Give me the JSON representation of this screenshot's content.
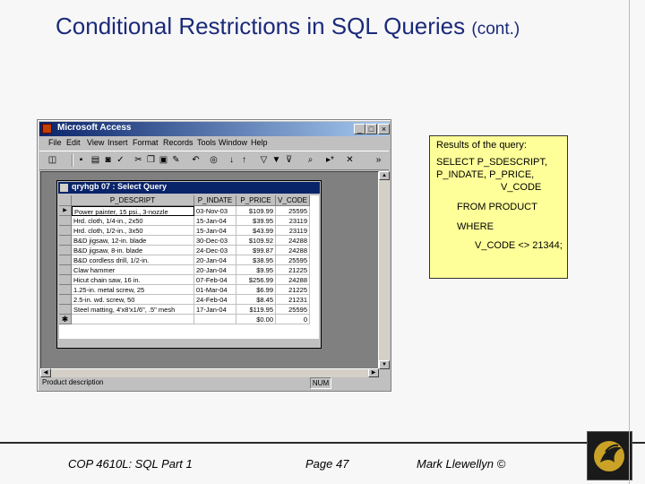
{
  "slide": {
    "title": "Conditional Restrictions in SQL Queries",
    "title_suffix": "(cont.)"
  },
  "access_window": {
    "title": "Microsoft Access",
    "controls": [
      "_",
      "□",
      "×"
    ],
    "menu": [
      "File",
      "Edit",
      "View",
      "Insert",
      "Format",
      "Records",
      "Tools",
      "Window",
      "Help"
    ],
    "toolbar_icons": [
      "view-icon",
      "save-icon",
      "print-icon",
      "print-preview-icon",
      "spelling-icon",
      "cut-icon",
      "copy-icon",
      "paste-icon",
      "format-painter-icon",
      "undo-icon",
      "insert-hyperlink-icon",
      "sort-ascending-icon",
      "sort-descending-icon",
      "filter-by-selection-icon",
      "filter-by-form-icon",
      "apply-filter-icon",
      "find-icon",
      "new-record-icon",
      "delete-record-icon"
    ],
    "status_text": "Product description",
    "status_num": "NUM"
  },
  "query_window": {
    "title": "qryhgb 07 : Select Query",
    "columns": [
      "P_DESCRIPT",
      "P_INDATE",
      "P_PRICE",
      "V_CODE"
    ],
    "rows": [
      {
        "desc": "Power painter, 15 psi., 3-nozzle",
        "date": "03-Nov-03",
        "price": "$109.99",
        "vcode": "25595"
      },
      {
        "desc": "Hrd. cloth, 1/4-in., 2x50",
        "date": "15-Jan-04",
        "price": "$39.95",
        "vcode": "23119"
      },
      {
        "desc": "Hrd. cloth, 1/2-in., 3x50",
        "date": "15-Jan-04",
        "price": "$43.99",
        "vcode": "23119"
      },
      {
        "desc": "B&D jigsaw, 12-in. blade",
        "date": "30-Dec-03",
        "price": "$109.92",
        "vcode": "24288"
      },
      {
        "desc": "B&D jigsaw, 8-in. blade",
        "date": "24-Dec-03",
        "price": "$99.87",
        "vcode": "24288"
      },
      {
        "desc": "B&D cordless drill, 1/2-in.",
        "date": "20-Jan-04",
        "price": "$38.95",
        "vcode": "25595"
      },
      {
        "desc": "Claw hammer",
        "date": "20-Jan-04",
        "price": "$9.95",
        "vcode": "21225"
      },
      {
        "desc": "Hicut chain saw, 16 in.",
        "date": "07-Feb-04",
        "price": "$256.99",
        "vcode": "24288"
      },
      {
        "desc": "1.25-in. metal screw, 25",
        "date": "01-Mar-04",
        "price": "$6.99",
        "vcode": "21225"
      },
      {
        "desc": "2.5-in. wd. screw, 50",
        "date": "24-Feb-04",
        "price": "$8.45",
        "vcode": "21231"
      },
      {
        "desc": "Steel matting, 4'x8'x1/6\", .5\" mesh",
        "date": "17-Jan-04",
        "price": "$119.95",
        "vcode": "25595"
      }
    ],
    "new_row": {
      "price": "$0.00",
      "vcode": "0"
    }
  },
  "note": {
    "heading": "Results of the query:",
    "lines": [
      "SELECT P_SDESCRIPT,",
      "P_INDATE,  P_PRICE,",
      "V_CODE",
      "FROM PRODUCT",
      "WHERE",
      "V_CODE <> 21344;"
    ]
  },
  "footer": {
    "course": "COP 4610L: SQL Part 1",
    "page": "Page 47",
    "author": "Mark Llewellyn ©"
  }
}
